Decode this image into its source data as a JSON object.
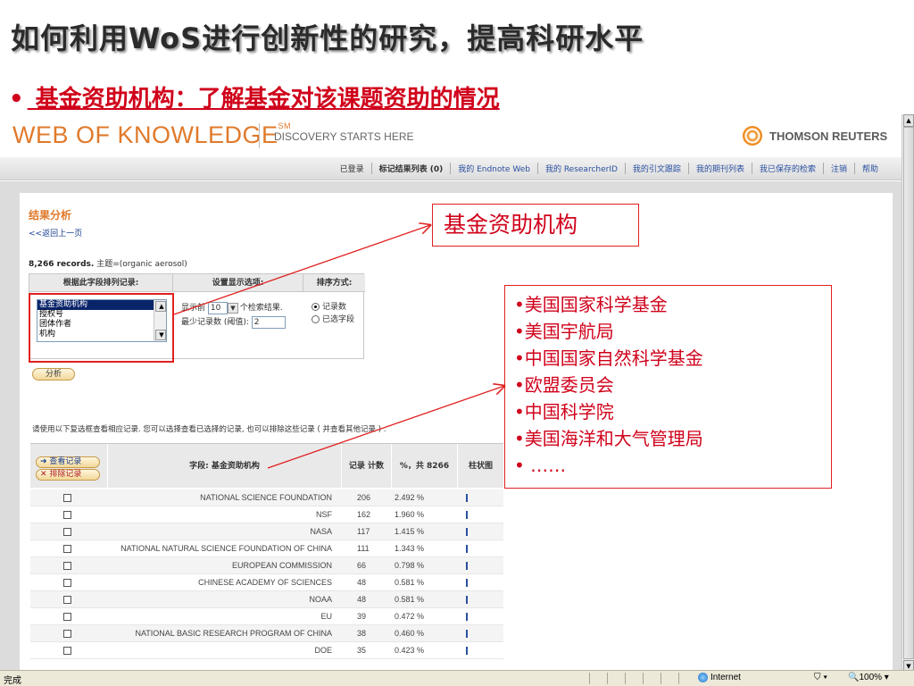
{
  "slide": {
    "title": "如何利用WoS进行创新性的研究，提高科研水平",
    "bullet_dot": "•",
    "bullet": " 基金资助机构：了解基金对该课题资助的情况"
  },
  "header": {
    "logo": "WEB OF KNOWLEDGE",
    "logo_mark": "SM",
    "tagline": "DISCOVERY STARTS HERE",
    "brand": "THOMSON REUTERS"
  },
  "nav": {
    "items": [
      "已登录",
      "标记结果列表 (0)",
      "我的 Endnote Web",
      "我的 ResearcherID",
      "我的引文跟踪",
      "我的期刊列表",
      "我已保存的检索",
      "注销",
      "帮助"
    ]
  },
  "analysis": {
    "title": "结果分析",
    "back": "<<返回上一页",
    "records_count": "8,266 records.",
    "records_query": " 主题=(organic aerosol)",
    "col_field": "根据此字段排列记录:",
    "col_display": "设置显示选项:",
    "col_sort": "排序方式:",
    "field_options": [
      "基金资助机构",
      "授权号",
      "团体作者",
      "机构"
    ],
    "show_prefix": "显示前",
    "show_value": "10",
    "show_suffix": "个检索结果.",
    "min_label": "最少记录数 (阈值):",
    "min_value": "2",
    "sort_opt1": "记录数",
    "sort_opt2": "已选字段",
    "analyze_button": "分析",
    "instruction": "请使用以下复选框查看相应记录. 您可以选择查看已选择的记录, 也可以排除这些记录 ( 并查看其他记录 ) ."
  },
  "results": {
    "view_button": "➜ 查看记录",
    "exclude_button": "✕ 排除记录",
    "col_field": "字段: 基金资助机构",
    "col_count": "记录 计数",
    "col_percent": "%，共 8266",
    "col_bar": "柱状图",
    "rows": [
      {
        "name": "NATIONAL SCIENCE FOUNDATION",
        "count": "206",
        "percent": "2.492 %"
      },
      {
        "name": "NSF",
        "count": "162",
        "percent": "1.960 %"
      },
      {
        "name": "NASA",
        "count": "117",
        "percent": "1.415 %"
      },
      {
        "name": "NATIONAL NATURAL SCIENCE FOUNDATION OF CHINA",
        "count": "111",
        "percent": "1.343 %"
      },
      {
        "name": "EUROPEAN COMMISSION",
        "count": "66",
        "percent": "0.798 %"
      },
      {
        "name": "CHINESE ACADEMY OF SCIENCES",
        "count": "48",
        "percent": "0.581 %"
      },
      {
        "name": "NOAA",
        "count": "48",
        "percent": "0.581 %"
      },
      {
        "name": "EU",
        "count": "39",
        "percent": "0.472 %"
      },
      {
        "name": "NATIONAL BASIC RESEARCH PROGRAM OF CHINA",
        "count": "38",
        "percent": "0.460 %"
      },
      {
        "name": "DOE",
        "count": "35",
        "percent": "0.423 %"
      }
    ]
  },
  "callouts": {
    "funding_label": "基金资助机构",
    "list": [
      "•美国国家科学基金",
      "•美国宇航局",
      "•中国国家自然科学基金",
      "•欧盟委员会",
      "•中国科学院",
      "•美国海洋和大气管理局",
      "• ……"
    ]
  },
  "status": {
    "done": "完成",
    "zone": "Internet",
    "zoom": "100%"
  },
  "colors": {
    "accent_red": "#d0021b",
    "brand_orange": "#e07a2b"
  }
}
